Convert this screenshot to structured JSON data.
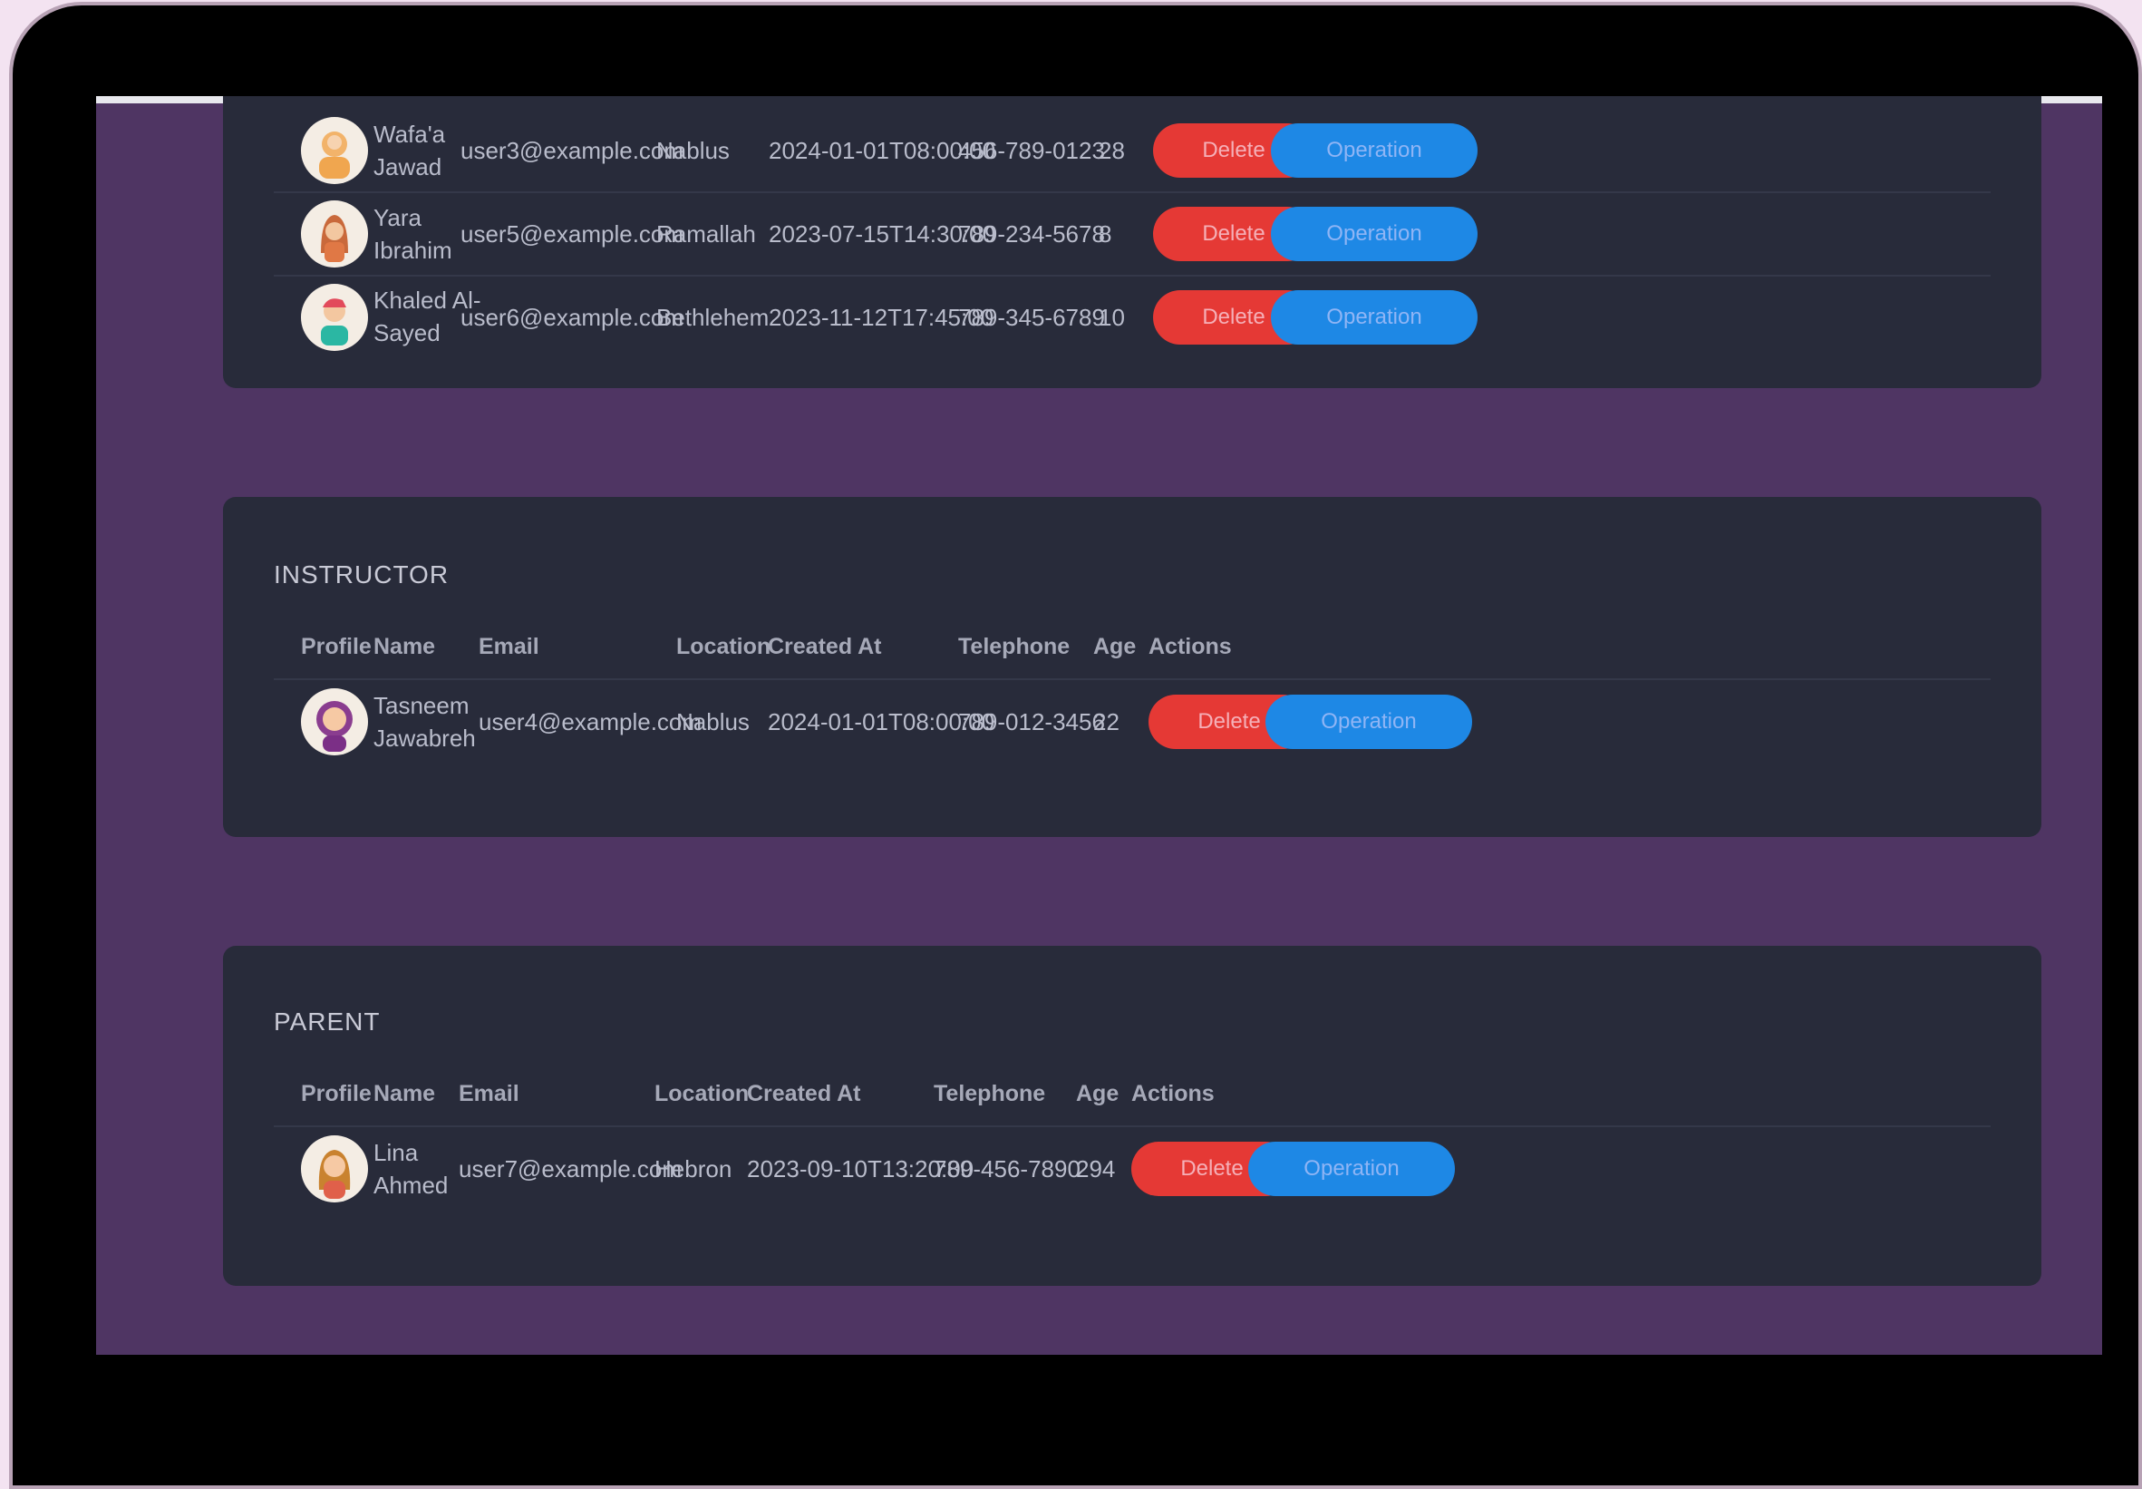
{
  "headers": [
    "Profile",
    "Name",
    "Email",
    "Location",
    "Created At",
    "Telephone",
    "Age",
    "Actions"
  ],
  "buttons": {
    "delete": "Delete",
    "operation": "Operation"
  },
  "top_table": {
    "rows": [
      {
        "name": "Wafa'a Jawad",
        "email": "user3@example.com",
        "location": "Nablus",
        "created_at": "2024-01-01T08:00:00",
        "telephone": "456-789-0123",
        "age": "28"
      },
      {
        "name": "Yara Ibrahim",
        "email": "user5@example.com",
        "location": "Ramallah",
        "created_at": "2023-07-15T14:30:00",
        "telephone": "789-234-5678",
        "age": "8"
      },
      {
        "name": "Khaled Al-Sayed",
        "email": "user6@example.com",
        "location": "Bethlehem",
        "created_at": "2023-11-12T17:45:00",
        "telephone": "789-345-6789",
        "age": "10"
      }
    ]
  },
  "instructor": {
    "title": "INSTRUCTOR",
    "rows": [
      {
        "name": "Tasneem Jawabreh",
        "email": "user4@example.com",
        "location": "Nablus",
        "created_at": "2024-01-01T08:00:00",
        "telephone": "789-012-3456",
        "age": "22"
      }
    ]
  },
  "parent": {
    "title": "PARENT",
    "rows": [
      {
        "name": "Lina Ahmed",
        "email": "user7@example.com",
        "location": "Hebron",
        "created_at": "2023-09-10T13:20:00",
        "telephone": "789-456-7890",
        "age": "294"
      }
    ]
  },
  "colors": {
    "background": "#4f3563",
    "card": "#282b3a",
    "delete": "#e53935",
    "operation": "#1e88e5"
  }
}
